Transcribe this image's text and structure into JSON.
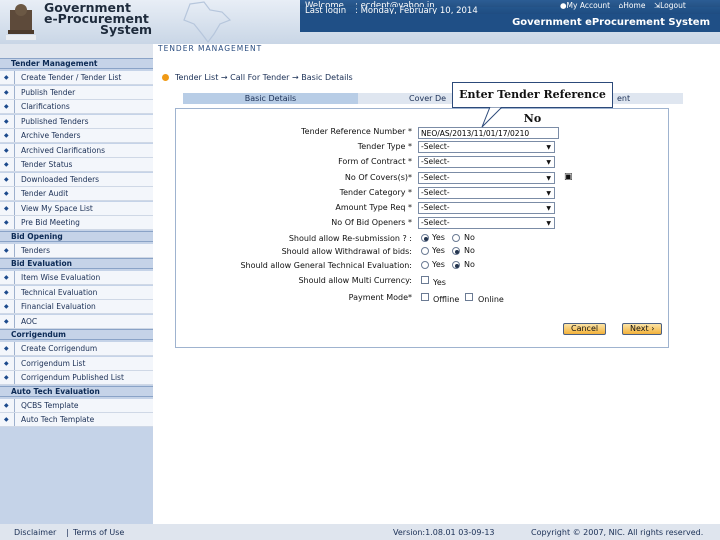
{
  "brand": {
    "line1": "Government",
    "line2": "e-Procurement",
    "line3": "System"
  },
  "header": {
    "welcome_label": "Welcome",
    "welcome_value": ": ecdept@yahoo.in",
    "lastlogin_label": "Last login",
    "lastlogin_value": ": Monday, February 10, 2014",
    "my_account": "My Account",
    "home": "Home",
    "logout": "Logout",
    "system_title": "Government eProcurement System"
  },
  "section_title": "TENDER MANAGEMENT",
  "sidebar": [
    {
      "type": "section",
      "label": "Tender Management"
    },
    {
      "type": "item",
      "label": "Create Tender / Tender List"
    },
    {
      "type": "item",
      "label": "Publish Tender"
    },
    {
      "type": "item",
      "label": "Clarifications"
    },
    {
      "type": "item",
      "label": "Published Tenders"
    },
    {
      "type": "item",
      "label": "Archive Tenders"
    },
    {
      "type": "item",
      "label": "Archived Clarifications"
    },
    {
      "type": "item",
      "label": "Tender Status"
    },
    {
      "type": "item",
      "label": "Downloaded Tenders"
    },
    {
      "type": "item",
      "label": "Tender Audit"
    },
    {
      "type": "item",
      "label": "View My Space List"
    },
    {
      "type": "item",
      "label": "Pre Bid Meeting"
    },
    {
      "type": "section",
      "label": "Bid Opening"
    },
    {
      "type": "item",
      "label": "Tenders"
    },
    {
      "type": "section",
      "label": "Bid Evaluation"
    },
    {
      "type": "item",
      "label": "Item Wise Evaluation"
    },
    {
      "type": "item",
      "label": "Technical Evaluation"
    },
    {
      "type": "item",
      "label": "Financial Evaluation"
    },
    {
      "type": "item",
      "label": "AOC"
    },
    {
      "type": "section",
      "label": "Corrigendum"
    },
    {
      "type": "item",
      "label": "Create Corrigendum"
    },
    {
      "type": "item",
      "label": "Corrigendum List"
    },
    {
      "type": "item",
      "label": "Corrigendum Published List"
    },
    {
      "type": "section",
      "label": "Auto Tech Evaluation"
    },
    {
      "type": "item",
      "label": "QCBS Template"
    },
    {
      "type": "item",
      "label": "Auto Tech Template"
    }
  ],
  "breadcrumb": {
    "b1": "Tender List",
    "sep": "→",
    "b2": "Call For Tender",
    "b3": "Basic Details"
  },
  "tabs": {
    "t1": "Basic Details",
    "t2": "Cover De",
    "t3": "ent"
  },
  "tooltip": "Enter Tender Reference No",
  "form": {
    "ref_label": "Tender Reference Number *",
    "ref_value": "NEO/AS/2013/11/01/17/0210",
    "type_label": "Tender Type *",
    "type_value": "-Select-",
    "contract_label": "Form of Contract *",
    "contract_value": "-Select-",
    "covers_label": "No Of Covers(s)*",
    "covers_value": "-Select-",
    "category_label": "Tender Category *",
    "category_value": "-Select-",
    "amount_label": "Amount Type Req *",
    "amount_value": "-Select-",
    "bid_label": "No Of Bid Openers *",
    "bid_value": "-Select-",
    "resub_label": "Should allow Re-submission ? :",
    "withdraw_label": "Should allow Withdrawal of bids:",
    "general_label": "Should allow General Technical Evaluation:",
    "multi_label": "Should allow Multi Currency:",
    "payment_label": "Payment Mode*",
    "yes": "Yes",
    "no": "No",
    "offline": "Offline",
    "online": "Online"
  },
  "buttons": {
    "cancel": "Cancel",
    "next": "Next"
  },
  "footer": {
    "disclaimer": "Disclaimer",
    "terms": "Terms of Use",
    "version": "Version:1.08.01 03-09-13",
    "copyright": "Copyright © 2007, NIC. All rights reserved."
  }
}
